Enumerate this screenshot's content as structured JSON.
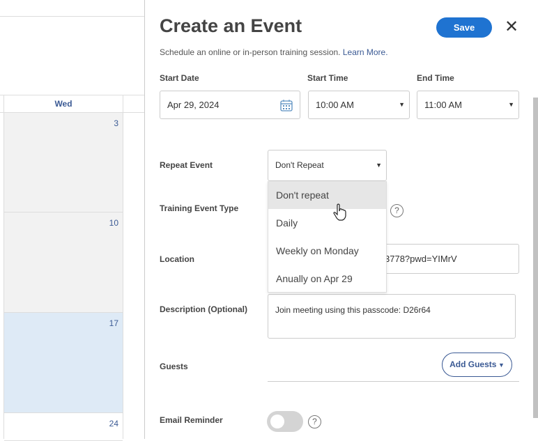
{
  "calendar": {
    "day_header": "Wed",
    "dates": [
      "3",
      "10",
      "17",
      "24"
    ]
  },
  "panel": {
    "title": "Create an Event",
    "save_label": "Save",
    "close_icon": "close-icon",
    "subtitle": "Schedule an online or in-person training session.",
    "learn_more": "Learn More.",
    "start_date": {
      "label": "Start Date",
      "value": "Apr 29, 2024"
    },
    "start_time": {
      "label": "Start Time",
      "value": "10:00 AM"
    },
    "end_time": {
      "label": "End Time",
      "value": "11:00 AM"
    },
    "repeat": {
      "label": "Repeat Event",
      "value": "Don't Repeat",
      "options": [
        "Don't repeat",
        "Daily",
        "Weekly on Monday",
        "Anually on Apr 29"
      ]
    },
    "event_type": {
      "label": "Training Event Type"
    },
    "location": {
      "label": "Location",
      "value": "3778?pwd=YIMrV"
    },
    "description": {
      "label": "Description (Optional)",
      "value": "Join meeting using this passcode: D26r64"
    },
    "guests": {
      "label": "Guests",
      "button": "Add Guests"
    },
    "email_reminder": {
      "label": "Email Reminder",
      "enabled": false
    }
  }
}
